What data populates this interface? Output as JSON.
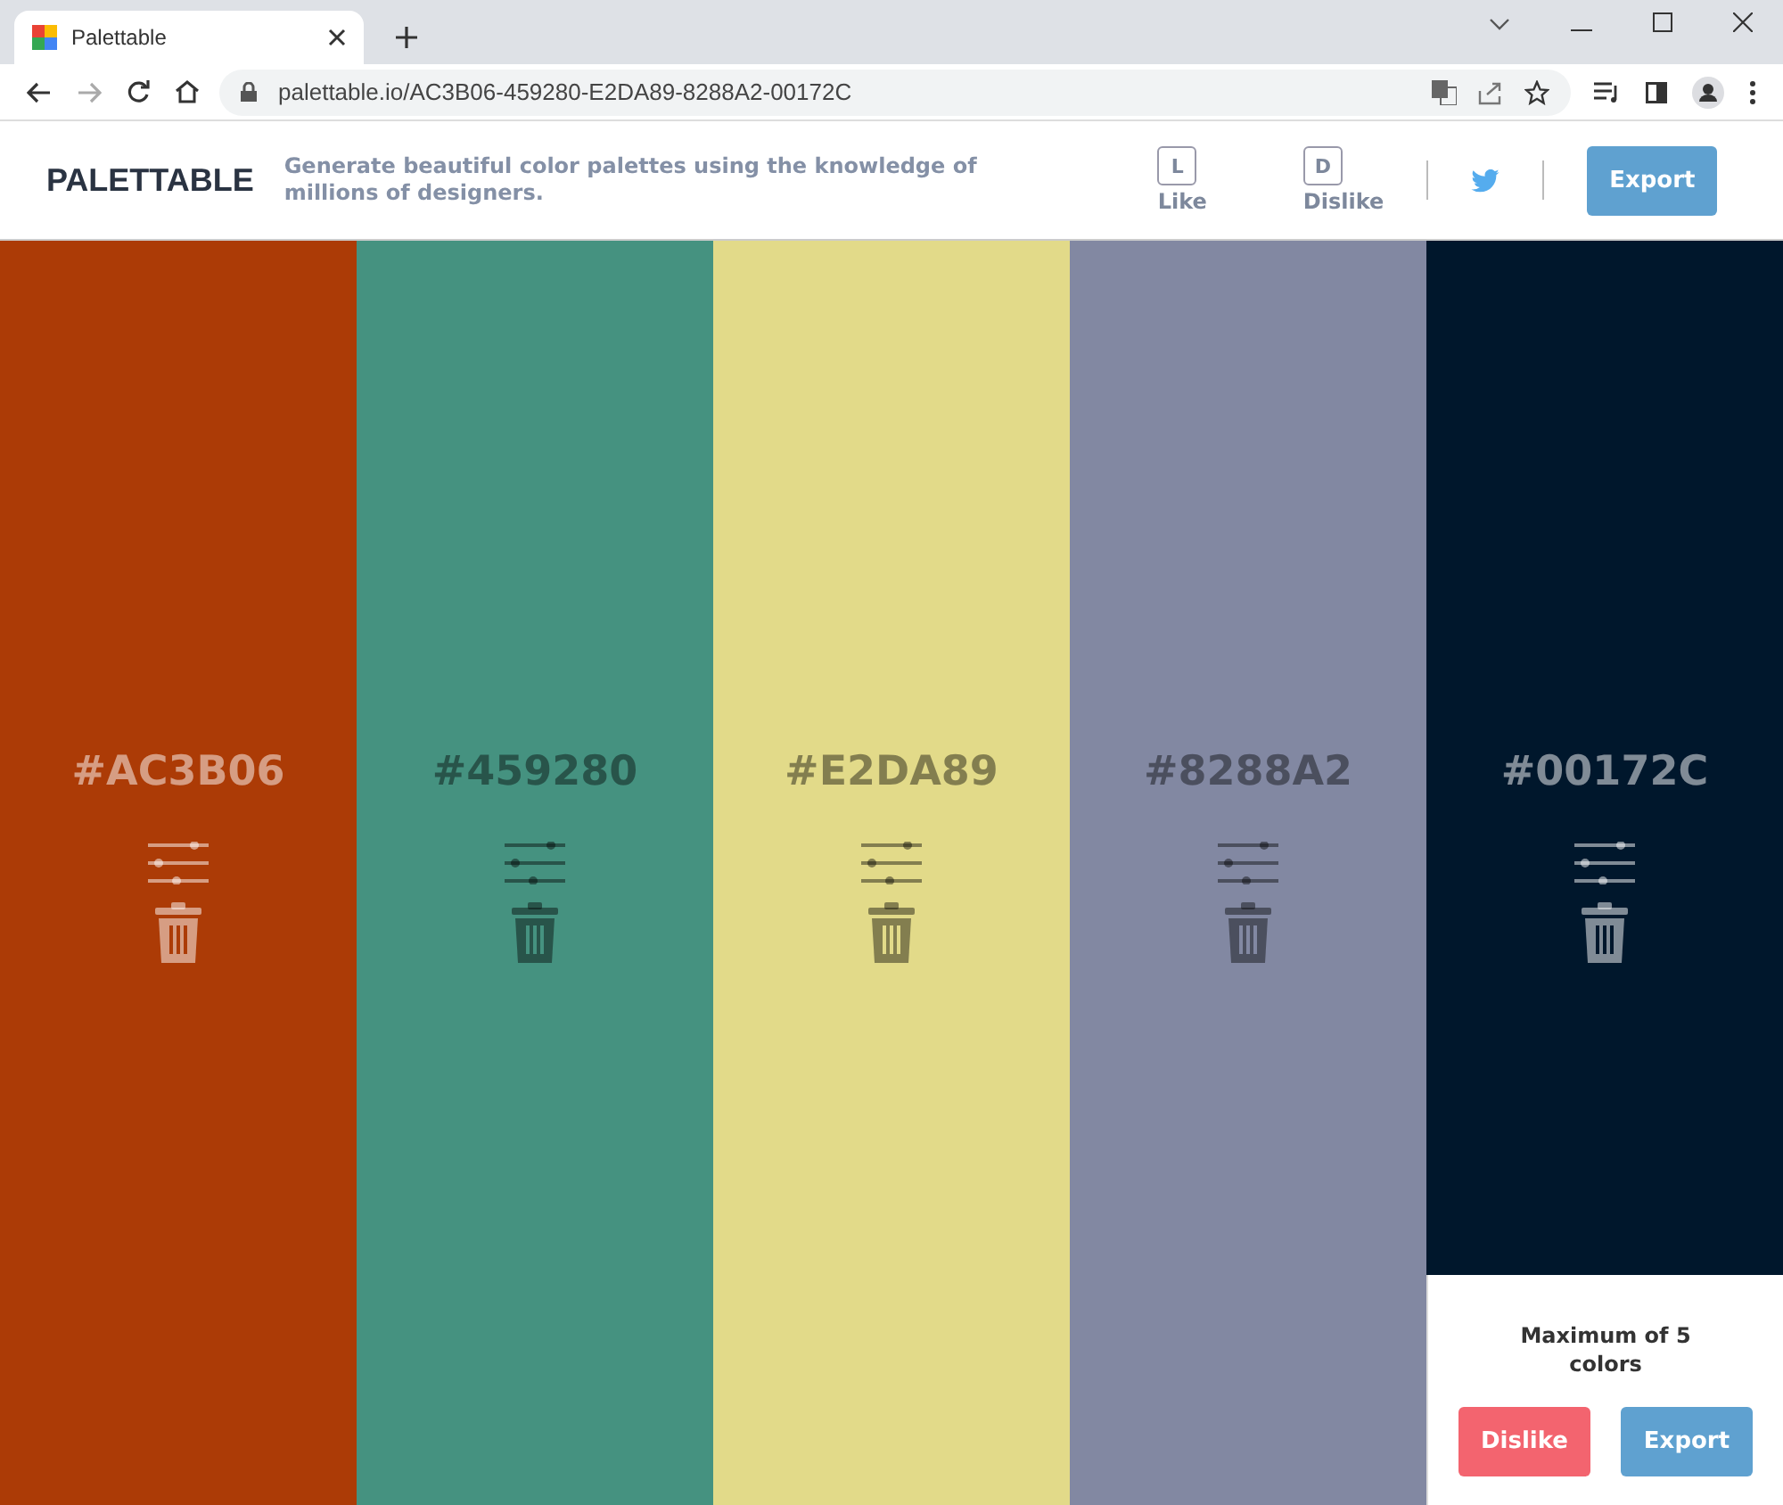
{
  "browser": {
    "tab_title": "Palettable",
    "url": "palettable.io/AC3B06-459280-E2DA89-8288A2-00172C"
  },
  "header": {
    "logo": "PALETTABLE",
    "tagline": "Generate beautiful color palettes using the knowledge of millions of designers.",
    "votes": [
      {
        "key": "L",
        "label": "Like"
      },
      {
        "key": "D",
        "label": "Dislike"
      }
    ],
    "export": "Export"
  },
  "swatches": [
    {
      "hex": "#AC3B06",
      "color": "#ac3b06"
    },
    {
      "hex": "#459280",
      "color": "#459280"
    },
    {
      "hex": "#E2DA89",
      "color": "#e2da89"
    },
    {
      "hex": "#8288A2",
      "color": "#8288a2"
    },
    {
      "hex": "#00172C",
      "color": "#00172c"
    }
  ],
  "panel": {
    "message": "Maximum of 5 colors",
    "dislike": "Dislike",
    "export": "Export"
  }
}
